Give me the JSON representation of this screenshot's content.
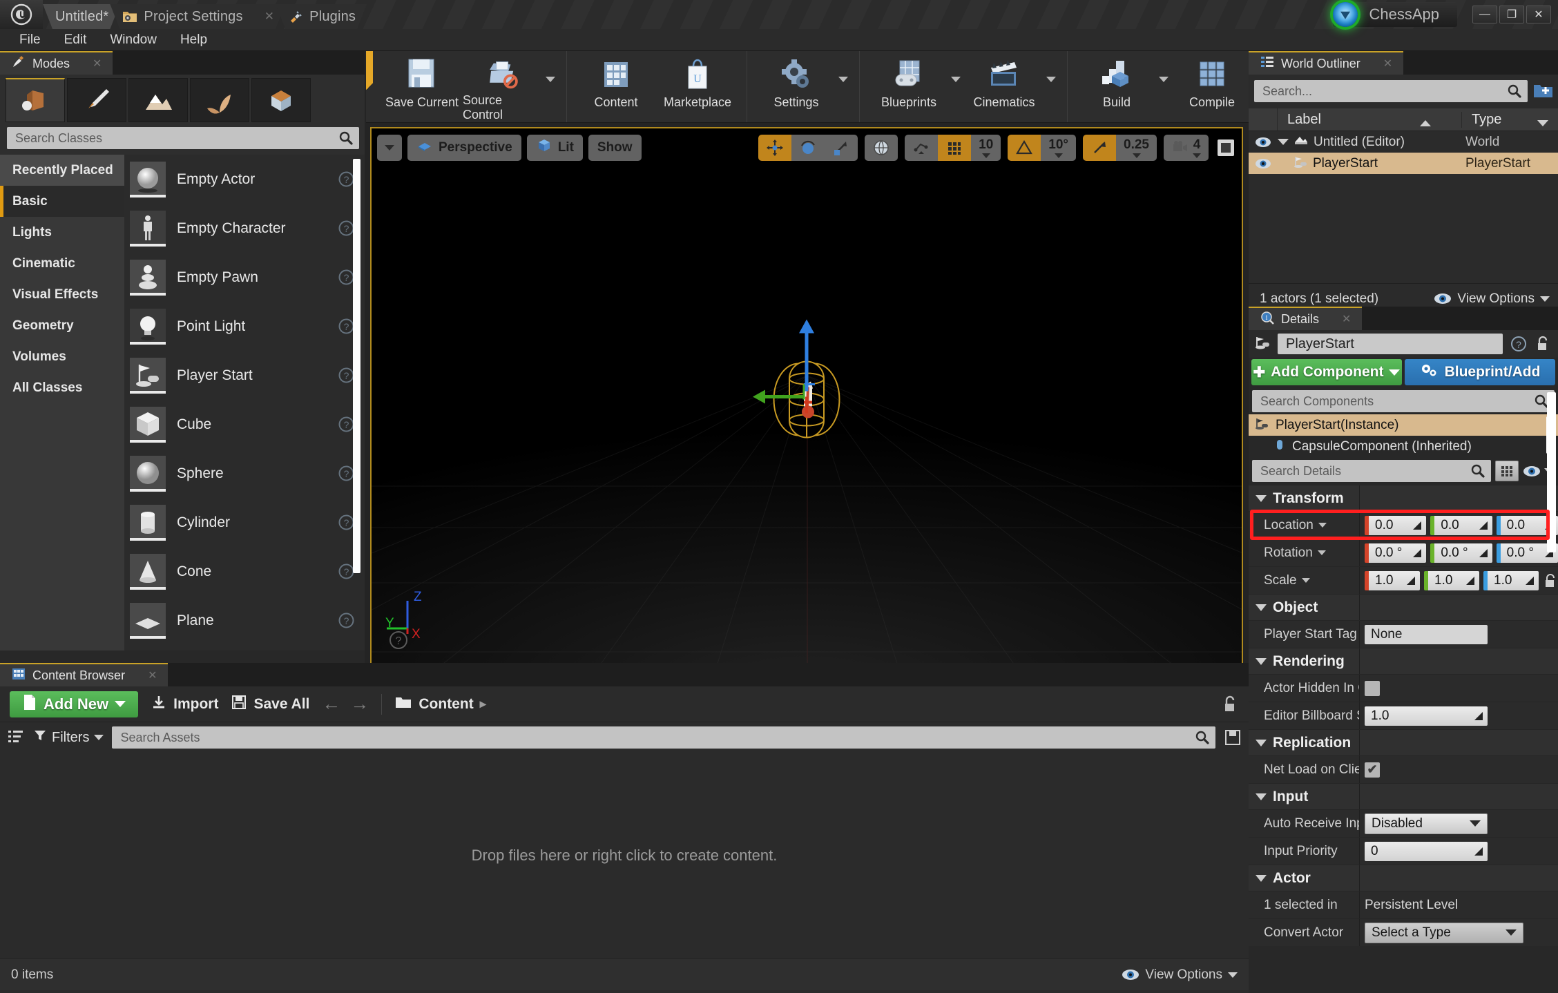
{
  "window": {
    "tabs": [
      {
        "label": "Untitled*",
        "icon": "ue-logo-icon",
        "active": true,
        "closable": false
      },
      {
        "label": "Project Settings",
        "icon": "folder-gear-icon",
        "active": false,
        "closable": true
      },
      {
        "label": "Plugins",
        "icon": "plug-icon",
        "active": false,
        "closable": true
      }
    ],
    "brand": "ChessApp",
    "brand_orb_color": "#1faa2a",
    "controls": {
      "minimize": "—",
      "maximize": "❐",
      "close": "✕"
    }
  },
  "menubar": {
    "items": [
      "File",
      "Edit",
      "Window",
      "Help"
    ]
  },
  "toolbar": {
    "groups": [
      {
        "buttons": [
          {
            "label": "Save Current",
            "icon": "floppy-disk-icon",
            "caret": false
          },
          {
            "label": "Source Control",
            "icon": "source-control-icon",
            "caret": true
          }
        ]
      },
      {
        "buttons": [
          {
            "label": "Content",
            "icon": "content-grid-icon",
            "caret": false
          },
          {
            "label": "Marketplace",
            "icon": "shopping-bag-icon",
            "caret": false
          }
        ]
      },
      {
        "buttons": [
          {
            "label": "Settings",
            "icon": "gears-icon",
            "caret": true
          }
        ]
      },
      {
        "buttons": [
          {
            "label": "Blueprints",
            "icon": "blueprint-gamepad-icon",
            "caret": true
          },
          {
            "label": "Cinematics",
            "icon": "clapperboard-icon",
            "caret": true
          }
        ]
      },
      {
        "buttons": [
          {
            "label": "Build",
            "icon": "build-blocks-icon",
            "caret": true
          },
          {
            "label": "Compile",
            "icon": "compile-cubes-icon",
            "caret": true
          }
        ]
      }
    ],
    "overflow": "»"
  },
  "modes_panel": {
    "tab_title": "Modes",
    "tab_icon": "modes-icon",
    "close_glyph": "✕",
    "mode_buttons": [
      {
        "name": "place-mode-icon",
        "selected": true
      },
      {
        "name": "paint-mode-icon",
        "selected": false
      },
      {
        "name": "landscape-mode-icon",
        "selected": false
      },
      {
        "name": "foliage-mode-icon",
        "selected": false
      },
      {
        "name": "geometry-mode-icon",
        "selected": false
      }
    ],
    "search_placeholder": "Search Classes",
    "categories": [
      {
        "label": "Recently Placed",
        "active": false
      },
      {
        "label": "Basic",
        "active": true
      },
      {
        "label": "Lights",
        "active": false
      },
      {
        "label": "Cinematic",
        "active": false
      },
      {
        "label": "Visual Effects",
        "active": false
      },
      {
        "label": "Geometry",
        "active": false
      },
      {
        "label": "Volumes",
        "active": false
      },
      {
        "label": "All Classes",
        "active": false
      }
    ],
    "items": [
      {
        "label": "Empty Actor",
        "icon": "sphere-thumb-icon"
      },
      {
        "label": "Empty Character",
        "icon": "mannequin-thumb-icon"
      },
      {
        "label": "Empty Pawn",
        "icon": "pawn-thumb-icon"
      },
      {
        "label": "Point Light",
        "icon": "bulb-thumb-icon"
      },
      {
        "label": "Player Start",
        "icon": "playerstart-thumb-icon"
      },
      {
        "label": "Cube",
        "icon": "cube-thumb-icon"
      },
      {
        "label": "Sphere",
        "icon": "sphere-thumb-icon"
      },
      {
        "label": "Cylinder",
        "icon": "cylinder-thumb-icon"
      },
      {
        "label": "Cone",
        "icon": "cone-thumb-icon"
      },
      {
        "label": "Plane",
        "icon": "plane-thumb-icon"
      }
    ]
  },
  "viewport": {
    "view_menu_caret": "▾",
    "perspective": "Perspective",
    "view_mode": "Lit",
    "show": "Show",
    "transform_tools": [
      {
        "name": "translate-tool",
        "active": true
      },
      {
        "name": "rotate-tool",
        "active": false
      },
      {
        "name": "scale-tool",
        "active": false
      }
    ],
    "world_space_icon": "globe-icon",
    "surface_snap_icon": "surface-snap-icon",
    "grid_snap": {
      "enabled": true,
      "value": "10"
    },
    "rotation_snap": {
      "enabled": true,
      "value": "10°"
    },
    "scale_snap": {
      "enabled": true,
      "value": "0.25"
    },
    "camera_speed": {
      "value": "4",
      "icon": "camera-icon"
    },
    "maximize_icon": "maximize-viewport-icon",
    "axis_labels": {
      "x": "X",
      "y": "Y",
      "z": "Z"
    },
    "help_icon": "question-icon"
  },
  "world_outliner": {
    "title": "World Outliner",
    "tab_icon": "outliner-list-icon",
    "close_glyph": "✕",
    "search_placeholder": "Search...",
    "add_icon": "add-folder-icon",
    "columns": [
      "Label",
      "Type"
    ],
    "rows": [
      {
        "label": "Untitled (Editor)",
        "type": "World",
        "selected": false,
        "depth": 0,
        "icon": "world-icon",
        "expander": true
      },
      {
        "label": "PlayerStart",
        "type": "PlayerStart",
        "selected": true,
        "depth": 1,
        "icon": "playerstart-icon",
        "expander": false
      }
    ],
    "footer_status": "1 actors (1 selected)",
    "view_options": "View Options"
  },
  "details": {
    "title": "Details",
    "tab_icon": "details-info-icon",
    "close_glyph": "✕",
    "actor_name": "PlayerStart",
    "actor_icon": "playerstart-icon",
    "help_icon": "question-icon",
    "lock_icon": "unlock-icon",
    "add_component_label": "Add Component",
    "blueprint_label": "Blueprint/Add",
    "component_search_placeholder": "Search Components",
    "components": [
      {
        "label": "PlayerStart(Instance)",
        "selected": true,
        "child": false,
        "icon": "playerstart-icon"
      },
      {
        "label": "CapsuleComponent (Inherited)",
        "selected": false,
        "child": true,
        "icon": "capsule-icon"
      }
    ],
    "details_search_placeholder": "Search Details",
    "grid_view_icon": "grid-view-icon",
    "eye_icon": "eye-icon",
    "sections": [
      {
        "name": "Transform",
        "rows": [
          {
            "label": "Location",
            "has_caret": true,
            "type": "vector3",
            "values": [
              "0.0",
              "0.0",
              "0.0"
            ],
            "highlighted": true
          },
          {
            "label": "Rotation",
            "has_caret": true,
            "type": "vector3",
            "values": [
              "0.0 °",
              "0.0 °",
              "0.0 °"
            ],
            "highlighted": false
          },
          {
            "label": "Scale",
            "has_caret": true,
            "type": "vector3-lock",
            "values": [
              "1.0",
              "1.0",
              "1.0"
            ],
            "highlighted": false
          }
        ]
      },
      {
        "name": "Object",
        "rows": [
          {
            "label": "Player Start Tag",
            "has_caret": false,
            "type": "text",
            "values": [
              "None"
            ],
            "highlighted": false
          }
        ]
      },
      {
        "name": "Rendering",
        "rows": [
          {
            "label": "Actor Hidden In G",
            "has_caret": false,
            "type": "checkbox",
            "values": [
              ""
            ],
            "checked": false,
            "highlighted": false
          },
          {
            "label": "Editor Billboard S",
            "has_caret": false,
            "type": "number",
            "values": [
              "1.0"
            ],
            "highlighted": false
          }
        ]
      },
      {
        "name": "Replication",
        "rows": [
          {
            "label": "Net Load on Clien",
            "has_caret": false,
            "type": "checkbox",
            "values": [
              ""
            ],
            "checked": true,
            "highlighted": false
          }
        ]
      },
      {
        "name": "Input",
        "rows": [
          {
            "label": "Auto Receive Inpu",
            "has_caret": false,
            "type": "select",
            "values": [
              "Disabled"
            ],
            "highlighted": false
          },
          {
            "label": "Input Priority",
            "has_caret": false,
            "type": "number",
            "values": [
              "0"
            ],
            "highlighted": false
          }
        ]
      },
      {
        "name": "Actor",
        "rows": [
          {
            "label": "1 selected in",
            "has_caret": false,
            "type": "plain",
            "values": [
              "Persistent Level"
            ],
            "highlighted": false
          },
          {
            "label": "Convert Actor",
            "has_caret": false,
            "type": "select",
            "values": [
              "Select a Type"
            ],
            "highlighted": false
          }
        ]
      }
    ]
  },
  "content_browser": {
    "title": "Content Browser",
    "tab_icon": "content-grid-icon",
    "close_glyph": "✕",
    "add_new_label": "Add New",
    "import_label": "Import",
    "save_all_label": "Save All",
    "back_glyph": "←",
    "forward_glyph": "→",
    "breadcrumb_root": "Content",
    "breadcrumb_arrow": "▸",
    "lock_icon": "unlock-icon",
    "filters_label": "Filters",
    "search_placeholder": "Search Assets",
    "empty_message": "Drop files here or right click to create content.",
    "item_count": "0 items",
    "view_options": "View Options"
  },
  "colors": {
    "accent_orange": "#c9a227",
    "selection_tan": "#d8b98e",
    "green_button": "#3f9b41",
    "blue_button": "#2a6fae",
    "highlight_red": "#ff1f1f",
    "axis_x": "#d4442a",
    "axis_y": "#6ab32a",
    "axis_z": "#3a9de0"
  }
}
